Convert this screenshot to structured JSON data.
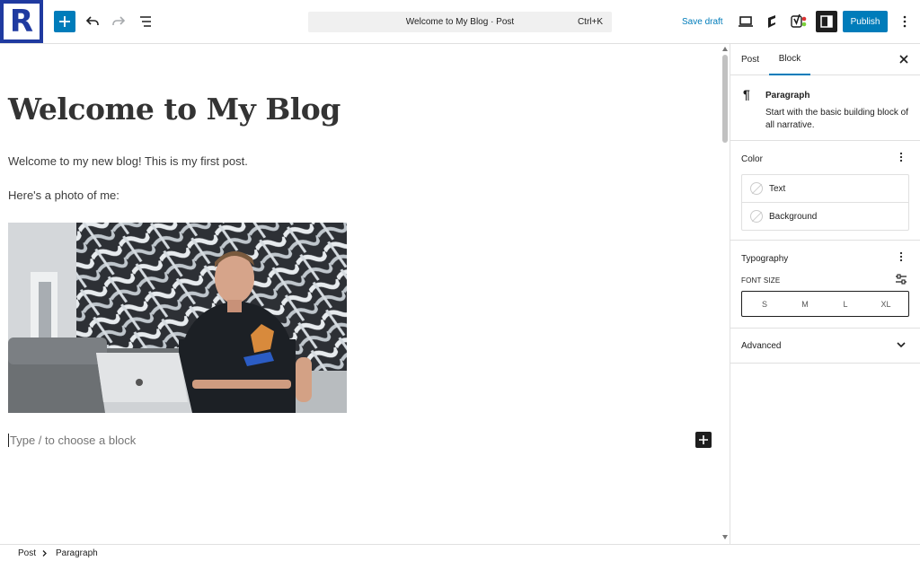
{
  "toolbar": {
    "logo_letter": "R",
    "command_title": "Welcome to My Blog · Post",
    "command_shortcut": "Ctrl+K",
    "save_draft": "Save draft",
    "publish": "Publish",
    "icons": [
      "add-block-icon",
      "undo-icon",
      "redo-icon",
      "document-overview-icon",
      "preview-icon",
      "jetpack-icon",
      "yoast-icon",
      "settings-icon",
      "options-icon"
    ],
    "accent_color": "#007cba"
  },
  "editor": {
    "title": "Welcome to My Blog",
    "paragraphs": [
      "Welcome to my new blog! This is my first post.",
      "Here's a photo of me:"
    ],
    "placeholder": "Type / to choose a block"
  },
  "sidebar": {
    "tabs": [
      "Post",
      "Block"
    ],
    "active_tab": "Block",
    "block": {
      "name": "Paragraph",
      "description": "Start with the basic building block of all narrative."
    },
    "color": {
      "title": "Color",
      "items": [
        "Text",
        "Background"
      ]
    },
    "typography": {
      "title": "Typography",
      "font_size_label": "FONT SIZE",
      "sizes": [
        "S",
        "M",
        "L",
        "XL"
      ]
    },
    "advanced": {
      "title": "Advanced"
    }
  },
  "footer": {
    "breadcrumb": [
      "Post",
      "Paragraph"
    ]
  }
}
